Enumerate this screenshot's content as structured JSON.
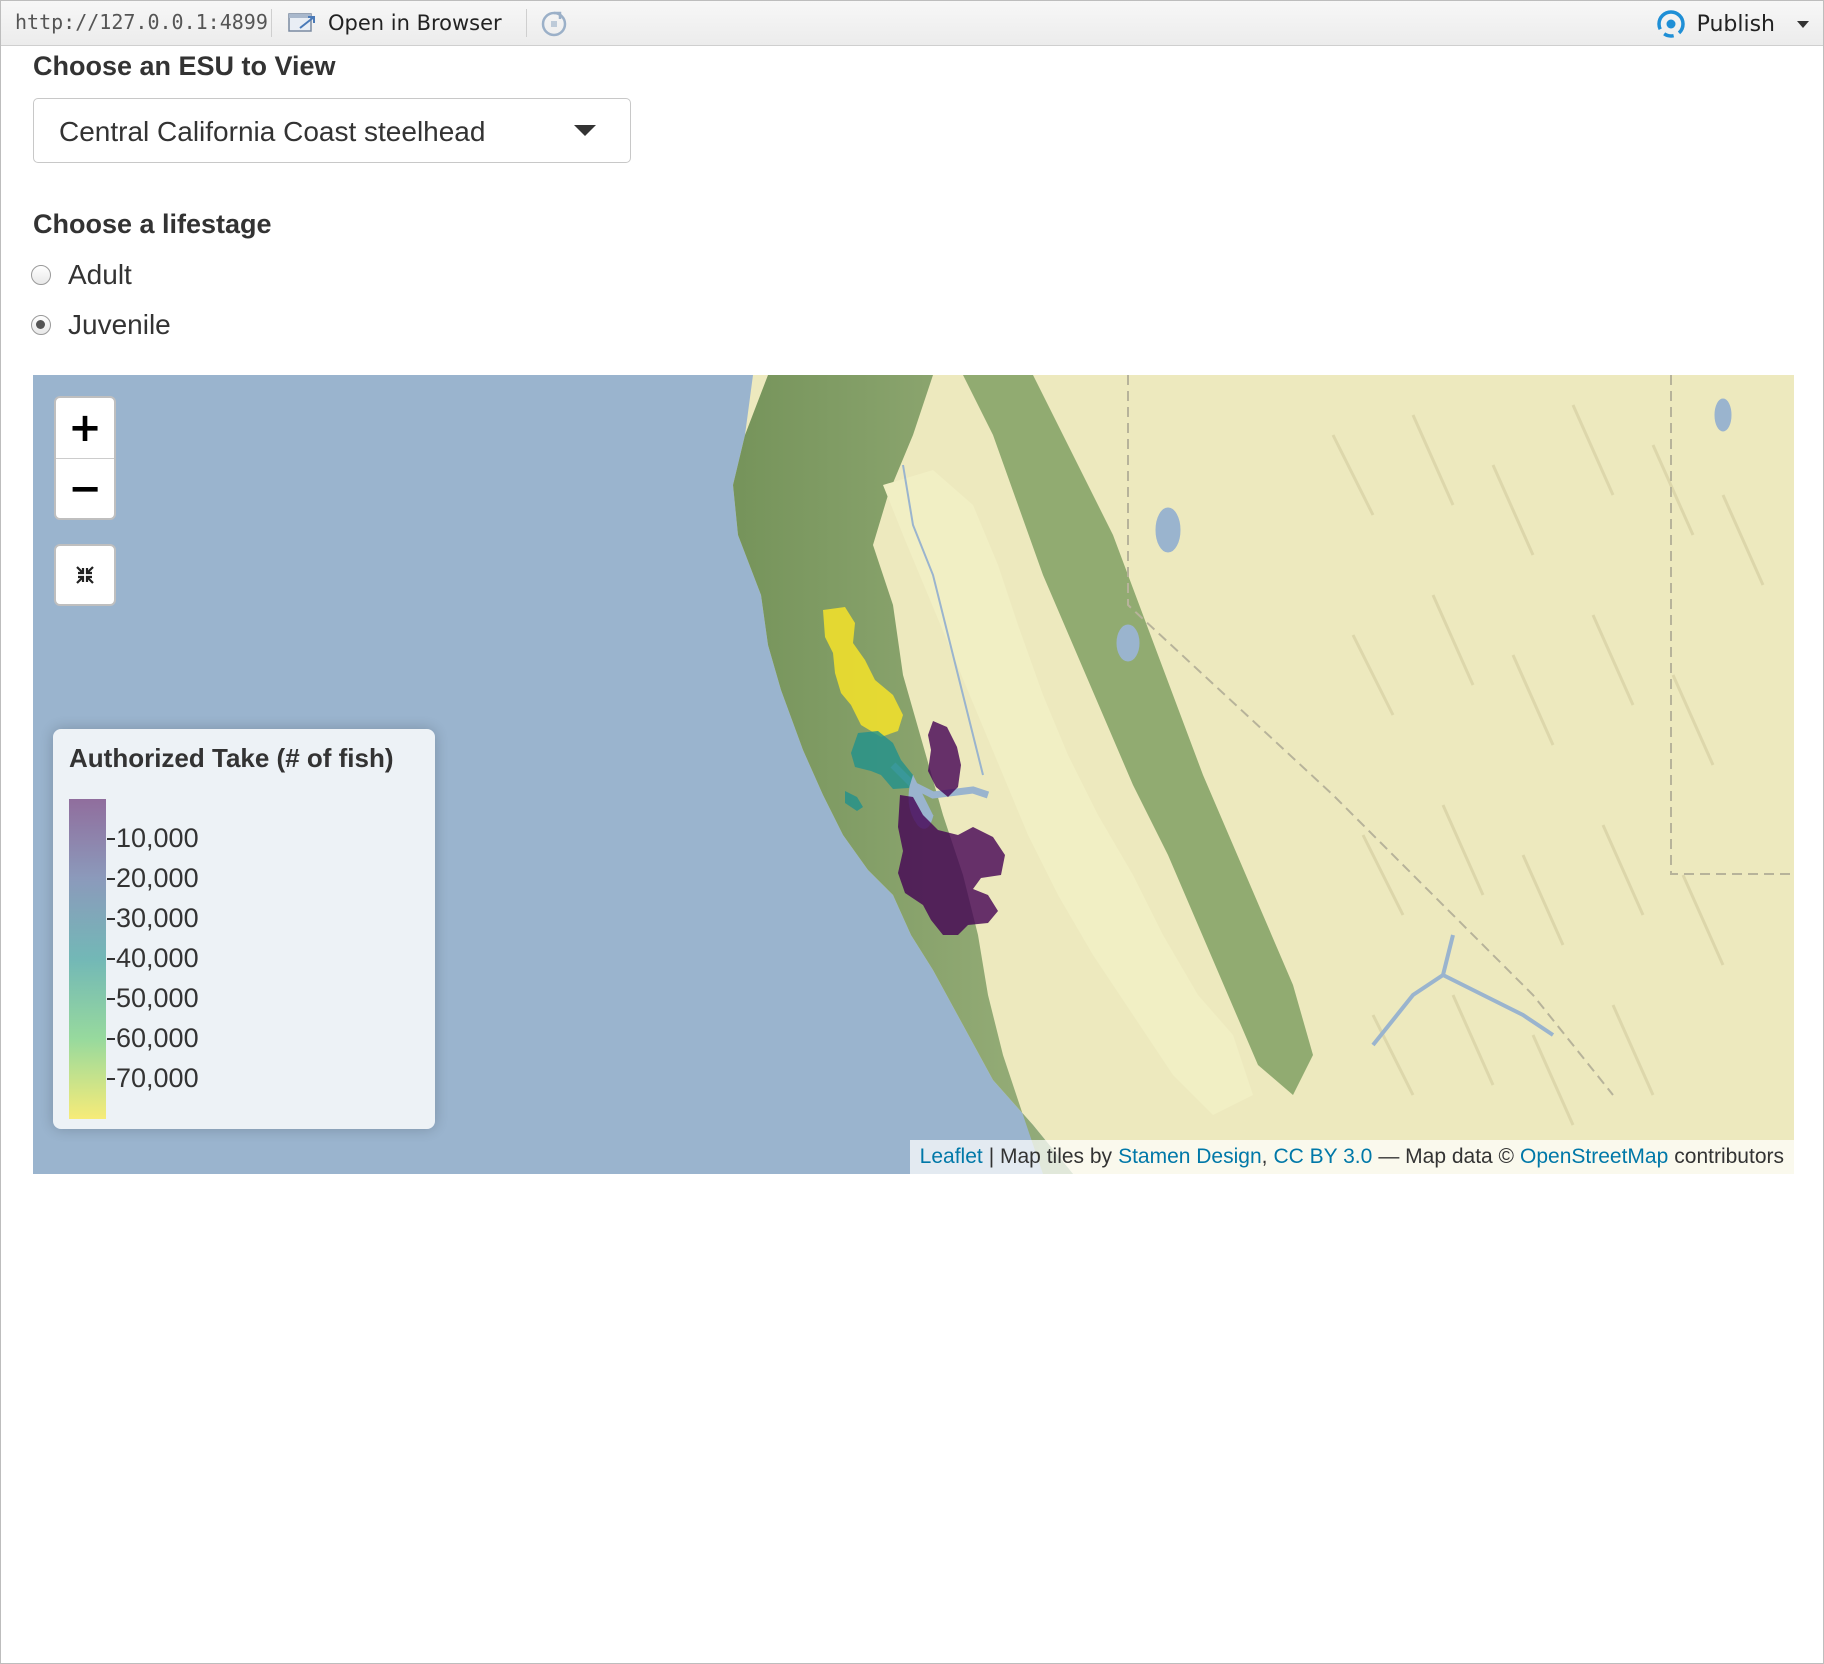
{
  "toolbar": {
    "url": "http://127.0.0.1:4899",
    "open_in_browser": "Open in Browser",
    "publish": "Publish"
  },
  "esu": {
    "label": "Choose an ESU to View",
    "selected": "Central California Coast steelhead"
  },
  "lifestage": {
    "label": "Choose a lifestage",
    "options": [
      {
        "label": "Adult",
        "checked": false
      },
      {
        "label": "Juvenile",
        "checked": true
      }
    ]
  },
  "map": {
    "zoom_in": "+",
    "zoom_out": "−",
    "legend": {
      "title": "Authorized Take (# of fish)",
      "ticks": [
        "10,000",
        "20,000",
        "30,000",
        "40,000",
        "50,000",
        "60,000",
        "70,000"
      ]
    },
    "attribution": {
      "leaflet": "Leaflet",
      "sep1": "| Map tiles by",
      "stamen": "Stamen Design",
      "comma": ",",
      "license": "CC BY 3.0",
      "sep2": "— Map data ©",
      "osm": "OpenStreetMap",
      "tail": "contributors"
    },
    "colors": {
      "ocean": "#9ab4ce",
      "land": "#ede9be",
      "forest": "#7e9c63",
      "viridis_low": "#440154",
      "viridis_mid": "#21918c",
      "viridis_high": "#fde725"
    }
  }
}
